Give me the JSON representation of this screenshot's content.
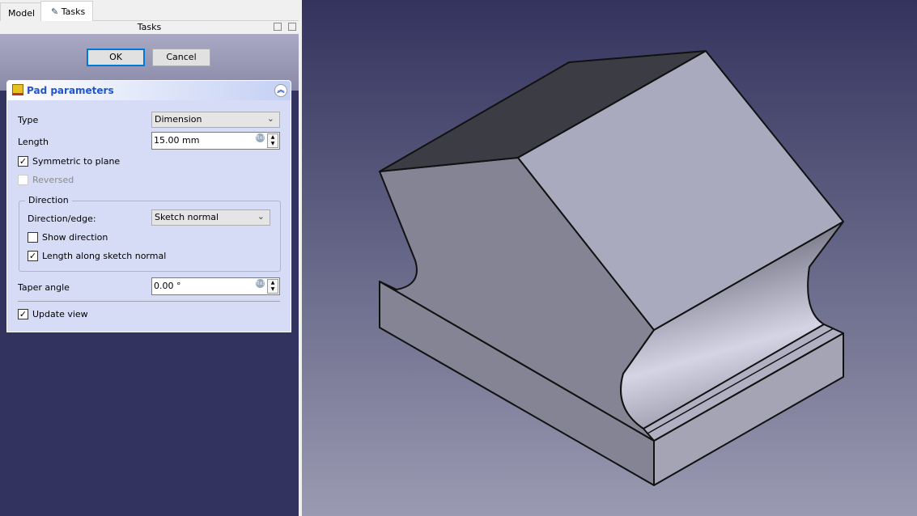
{
  "tabs": [
    {
      "label": "Model"
    },
    {
      "label": "Tasks"
    }
  ],
  "panel_title": "Tasks",
  "buttons": {
    "ok": "OK",
    "cancel": "Cancel"
  },
  "pad": {
    "title": "Pad parameters",
    "type_label": "Type",
    "type_value": "Dimension",
    "length_label": "Length",
    "length_value": "15.00 mm",
    "symmetric": {
      "label": "Symmetric to plane",
      "checked": true
    },
    "reversed": {
      "label": "Reversed",
      "checked": false,
      "disabled": true
    },
    "direction": {
      "title": "Direction",
      "edge_label": "Direction/edge:",
      "edge_value": "Sketch normal",
      "show_direction": {
        "label": "Show direction",
        "checked": false
      },
      "along_normal": {
        "label": "Length along sketch normal",
        "checked": true
      }
    },
    "taper_label": "Taper angle",
    "taper_value": "0.00 °",
    "update_view": {
      "label": "Update view",
      "checked": true
    }
  },
  "check_mark": "✓"
}
